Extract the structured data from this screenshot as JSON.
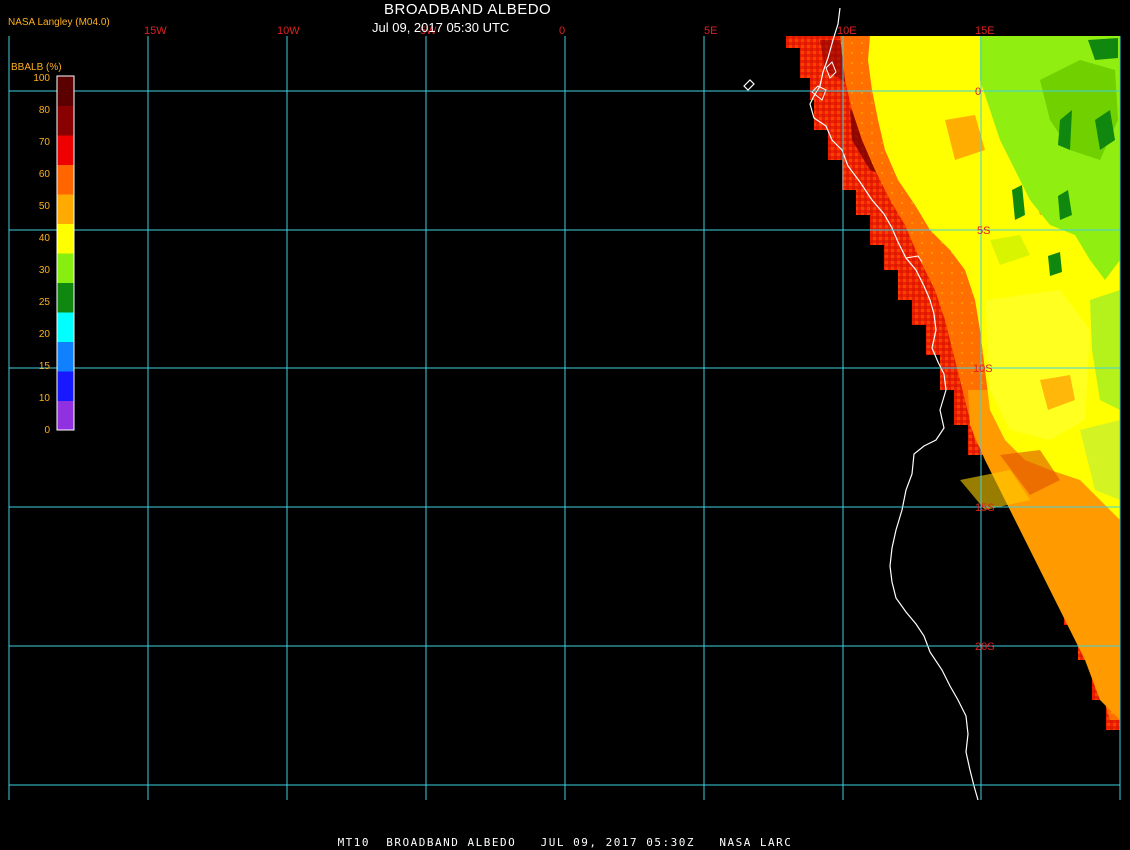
{
  "header": {
    "title": "BROADBAND ALBEDO",
    "subtitle": "Jul 09, 2017 05:30 UTC",
    "provider": "NASA Langley (M04.0)"
  },
  "colorbar": {
    "title": "BBALB (%)",
    "ticks": [
      "0",
      "10",
      "15",
      "20",
      "25",
      "30",
      "40",
      "50",
      "60",
      "70",
      "80",
      "100"
    ],
    "colors": [
      "#9030e0",
      "#1818ff",
      "#1080ff",
      "#00ffff",
      "#108810",
      "#88ee10",
      "#ffff00",
      "#ffaa00",
      "#ff6600",
      "#ee0000",
      "#880000",
      "#5a0000"
    ]
  },
  "grid": {
    "lon_labels": [
      "15W",
      "10W",
      "5W",
      "0",
      "5E",
      "10E",
      "15E"
    ],
    "lat_labels": [
      "0",
      "5S",
      "10S",
      "15S",
      "20S"
    ],
    "line_color": "#40d0e0"
  },
  "footer": {
    "text": "MT10  BROADBAND ALBEDO   JUL 09, 2017 05:30Z   NASA LARC"
  }
}
